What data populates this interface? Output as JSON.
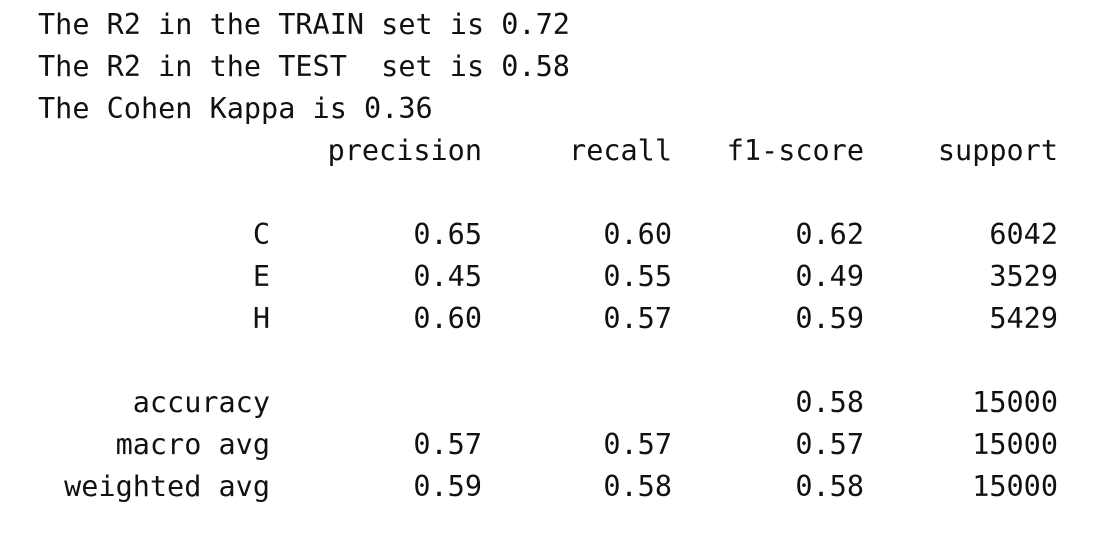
{
  "summary_lines": [
    "The R2 in the TRAIN set is 0.72",
    "The R2 in the TEST  set is 0.58",
    "The Cohen Kappa is 0.36"
  ],
  "report": {
    "headers": {
      "precision": "precision",
      "recall": "recall",
      "f1": "f1-score",
      "support": "support"
    },
    "classes": [
      {
        "label": "C",
        "precision": "0.65",
        "recall": "0.60",
        "f1": "0.62",
        "support": "6042"
      },
      {
        "label": "E",
        "precision": "0.45",
        "recall": "0.55",
        "f1": "0.49",
        "support": "3529"
      },
      {
        "label": "H",
        "precision": "0.60",
        "recall": "0.57",
        "f1": "0.59",
        "support": "5429"
      }
    ],
    "accuracy": {
      "label": "accuracy",
      "f1": "0.58",
      "support": "15000"
    },
    "macro_avg": {
      "label": "macro avg",
      "precision": "0.57",
      "recall": "0.57",
      "f1": "0.57",
      "support": "15000"
    },
    "weighted_avg": {
      "label": "weighted avg",
      "precision": "0.59",
      "recall": "0.58",
      "f1": "0.58",
      "support": "15000"
    }
  }
}
